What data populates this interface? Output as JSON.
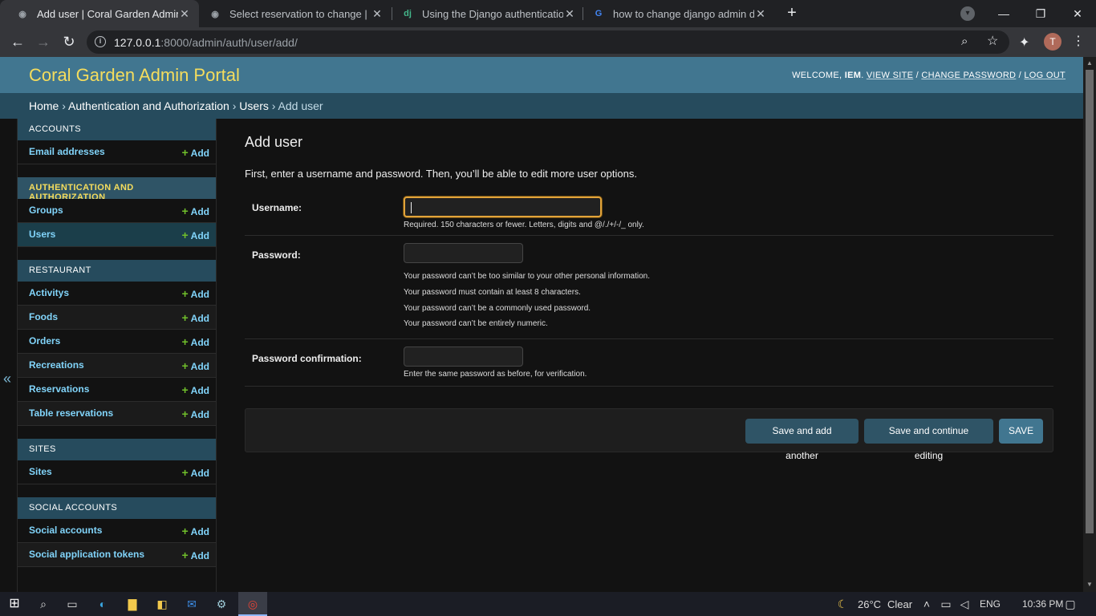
{
  "browser": {
    "tabs": [
      {
        "title": "Add user | Coral Garden Admin P",
        "active": true
      },
      {
        "title": "Select reservation to change | Co",
        "active": false
      },
      {
        "title": "Using the Django authentication",
        "active": false
      },
      {
        "title": "how to change django admin dis",
        "active": false
      }
    ],
    "url_host": "127.0.0.1",
    "url_rest": ":8000/admin/auth/user/add/",
    "profile_initial": "T"
  },
  "admin": {
    "site_title": "Coral Garden Admin Portal",
    "welcome": "WELCOME,",
    "username": "IEM",
    "view_site": "VIEW SITE",
    "change_password": "CHANGE PASSWORD",
    "log_out": "LOG OUT",
    "breadcrumbs": {
      "home": "Home",
      "app": "Authentication and Authorization",
      "model": "Users",
      "current": "Add user"
    }
  },
  "sidebar": {
    "add_label": "Add",
    "apps": [
      {
        "name": "ACCOUNTS",
        "current": false,
        "models": [
          {
            "name": "Email addresses",
            "current": false
          }
        ]
      },
      {
        "name": "AUTHENTICATION AND AUTHORIZATION",
        "current": true,
        "models": [
          {
            "name": "Groups",
            "current": false
          },
          {
            "name": "Users",
            "current": true
          }
        ]
      },
      {
        "name": "RESTAURANT",
        "current": false,
        "models": [
          {
            "name": "Activitys",
            "current": false
          },
          {
            "name": "Foods",
            "current": false
          },
          {
            "name": "Orders",
            "current": false
          },
          {
            "name": "Recreations",
            "current": false
          },
          {
            "name": "Reservations",
            "current": false
          },
          {
            "name": "Table reservations",
            "current": false
          }
        ]
      },
      {
        "name": "SITES",
        "current": false,
        "models": [
          {
            "name": "Sites",
            "current": false
          }
        ]
      },
      {
        "name": "SOCIAL ACCOUNTS",
        "current": false,
        "models": [
          {
            "name": "Social accounts",
            "current": false
          },
          {
            "name": "Social application tokens",
            "current": false
          }
        ]
      }
    ]
  },
  "form": {
    "title": "Add user",
    "intro": "First, enter a username and password. Then, you’ll be able to edit more user options.",
    "username_label": "Username:",
    "username_value": "",
    "username_help": "Required. 150 characters or fewer. Letters, digits and @/./+/-/_ only.",
    "password_label": "Password:",
    "password_help": [
      "Your password can’t be too similar to your other personal information.",
      "Your password must contain at least 8 characters.",
      "Your password can’t be a commonly used password.",
      "Your password can’t be entirely numeric."
    ],
    "password2_label": "Password confirmation:",
    "password2_help": "Enter the same password as before, for verification.",
    "save_add_another": "Save and add another",
    "save_continue": "Save and continue editing",
    "save": "SAVE"
  },
  "taskbar": {
    "temperature": "26°C",
    "weather": "Clear",
    "language": "ENG",
    "time": "10:36 PM"
  },
  "colors": {
    "header": "#417690",
    "breadcrumbs": "#264b5d",
    "brand_text": "#f5dd5d",
    "link": "#81d4fa",
    "add_plus": "#70bf2b",
    "focus_border": "#e1a33a"
  }
}
